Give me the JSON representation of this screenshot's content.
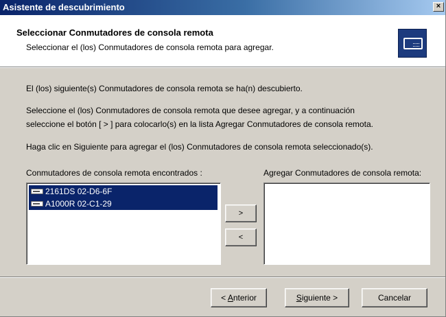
{
  "window": {
    "title": "Asistente de descubrimiento",
    "close": "×"
  },
  "header": {
    "title": "Seleccionar Conmutadores de consola remota",
    "subtitle": "Seleccionar el (los) Conmutadores de consola remota para agregar."
  },
  "body": {
    "line1": "El (los) siguiente(s) Conmutadores de consola remota se ha(n) descubierto.",
    "line2a": "Seleccione el (los) Conmutadores de consola remota que desee agregar, y a continuación",
    "line2b": "seleccione el botón [ > ] para colocarlo(s) en la lista Agregar Conmutadores de consola remota.",
    "line3": "Haga clic en Siguiente para agregar el (los) Conmutadores de consola remota seleccionado(s)."
  },
  "found": {
    "label": "Conmutadores de consola remota encontrados :",
    "items": [
      {
        "label": "2161DS 02-D6-6F",
        "icon": "switch-device-icon",
        "selected": true
      },
      {
        "label": "A1000R 02-C1-29",
        "icon": "switch-device-icon",
        "selected": true
      }
    ]
  },
  "add": {
    "label": "Agregar Conmutadores de consola remota:",
    "items": []
  },
  "transfer": {
    "add": ">",
    "remove": "<"
  },
  "nav": {
    "back_prefix": "< ",
    "back_key": "A",
    "back_rest": "nterior",
    "next_key": "S",
    "next_rest": "iguiente >",
    "cancel": "Cancelar"
  },
  "colors": {
    "titlebar_start": "#0a246a",
    "selection": "#0a246a",
    "face": "#d4d0c8",
    "icon_bg": "#1d3b7e"
  }
}
